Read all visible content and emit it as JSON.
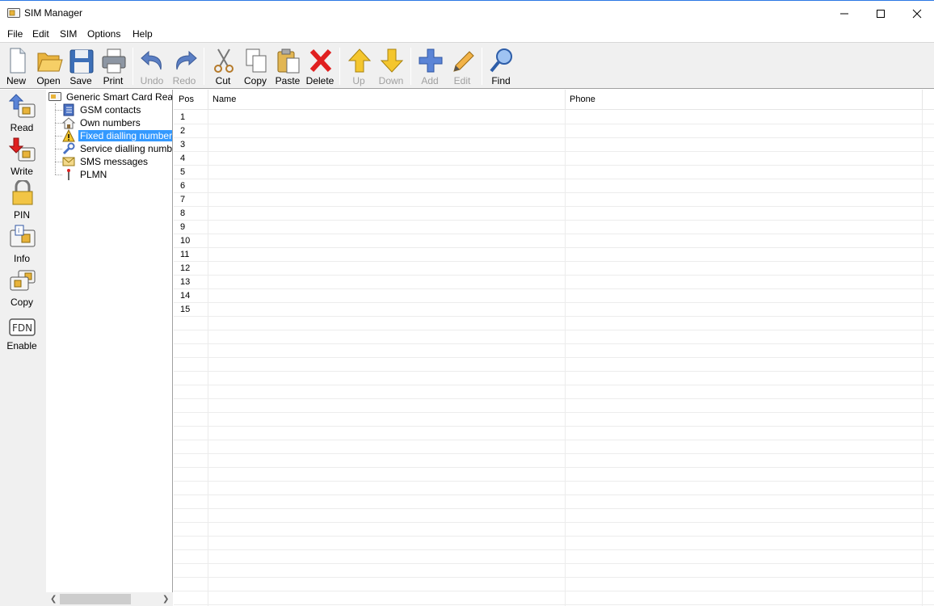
{
  "window": {
    "title": "SIM Manager"
  },
  "menu": [
    "File",
    "Edit",
    "SIM",
    "Options",
    "Help"
  ],
  "toolbar": {
    "new": "New",
    "open": "Open",
    "save": "Save",
    "print": "Print",
    "undo": "Undo",
    "redo": "Redo",
    "cut": "Cut",
    "copy": "Copy",
    "paste": "Paste",
    "delete": "Delete",
    "up": "Up",
    "down": "Down",
    "add": "Add",
    "edit": "Edit",
    "find": "Find"
  },
  "sidebar": {
    "read": "Read",
    "write": "Write",
    "pin": "PIN",
    "info": "Info",
    "copy": "Copy",
    "enable": "Enable",
    "fdn_icon_text": "FDN"
  },
  "tree": {
    "root": "Generic  Smart Card Reader",
    "items": [
      "GSM contacts",
      "Own numbers",
      "Fixed dialling numbers",
      "Service dialling numbers",
      "SMS messages",
      "PLMN"
    ],
    "selected": "Fixed dialling numbers"
  },
  "grid": {
    "columns": [
      "Pos",
      "Name",
      "Phone"
    ],
    "rows": [
      "1",
      "2",
      "3",
      "4",
      "5",
      "6",
      "7",
      "8",
      "9",
      "10",
      "11",
      "12",
      "13",
      "14",
      "15"
    ]
  },
  "colors": {
    "selection": "#3399ff",
    "disabled_text": "#a0a0a0"
  }
}
